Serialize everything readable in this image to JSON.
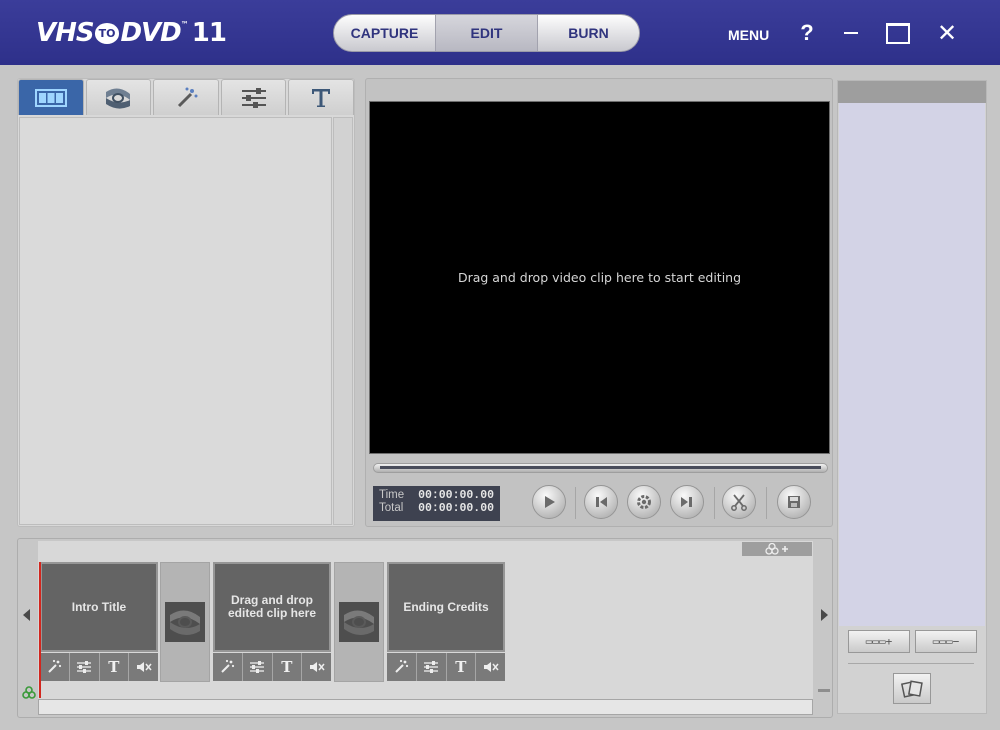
{
  "app": {
    "logo_vhs": "VHS",
    "logo_to": "TO",
    "logo_dvd": "DVD",
    "logo_tm": "™",
    "logo_version": "11"
  },
  "modes": [
    {
      "label": "CAPTURE",
      "active": false
    },
    {
      "label": "EDIT",
      "active": true
    },
    {
      "label": "BURN",
      "active": false
    }
  ],
  "window": {
    "menu_label": "MENU",
    "help_label": "?",
    "close_label": "✕"
  },
  "library_tabs": [
    {
      "icon": "filmstrip-icon",
      "active": true
    },
    {
      "icon": "transition-icon",
      "active": false
    },
    {
      "icon": "magic-wand-icon",
      "active": false
    },
    {
      "icon": "sliders-icon",
      "active": false
    },
    {
      "icon": "text-icon",
      "active": false
    }
  ],
  "preview": {
    "message": "Drag and drop video clip here to start editing",
    "time_label": "Time",
    "total_label": "Total",
    "time_value": "00:00:00.00",
    "total_value": "00:00:00.00"
  },
  "storyboard": {
    "clips": [
      {
        "label": "Intro Title"
      },
      {
        "label": "Drag and drop edited clip here"
      },
      {
        "label": "Ending Credits"
      }
    ],
    "tool_text_glyph": "T"
  },
  "colors": {
    "titlebar": "#2e308a",
    "active_tab": "#3a66a8",
    "playhead": "#d2261e"
  }
}
